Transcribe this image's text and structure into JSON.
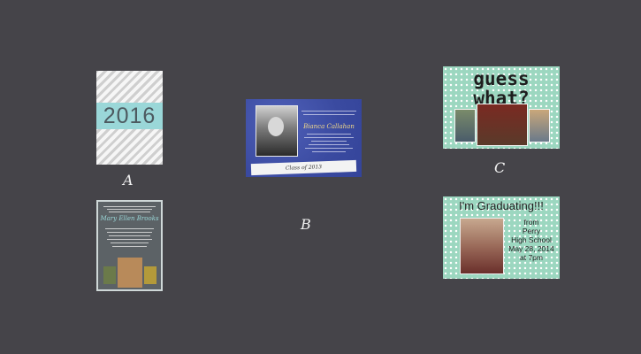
{
  "labels": {
    "a": "A",
    "b": "B",
    "c": "C"
  },
  "cardA1": {
    "year": "2016"
  },
  "cardA2": {
    "name": "Mary Ellen Brooks"
  },
  "cardB": {
    "name": "Bianca Callahan",
    "banner": "Class of 2013"
  },
  "cardC1": {
    "headline": "guess what?"
  },
  "cardC2": {
    "headline": "I'm Graduating!!!",
    "line1": "from",
    "line2": "Perry",
    "line3": "High School",
    "line4": "May 28, 2014",
    "line5": "at 7pm"
  },
  "colors": {
    "background": "#454449",
    "mint": "#9cd7c0",
    "aqua": "#9ad7d8",
    "royal_blue": "#3d4fa8"
  }
}
